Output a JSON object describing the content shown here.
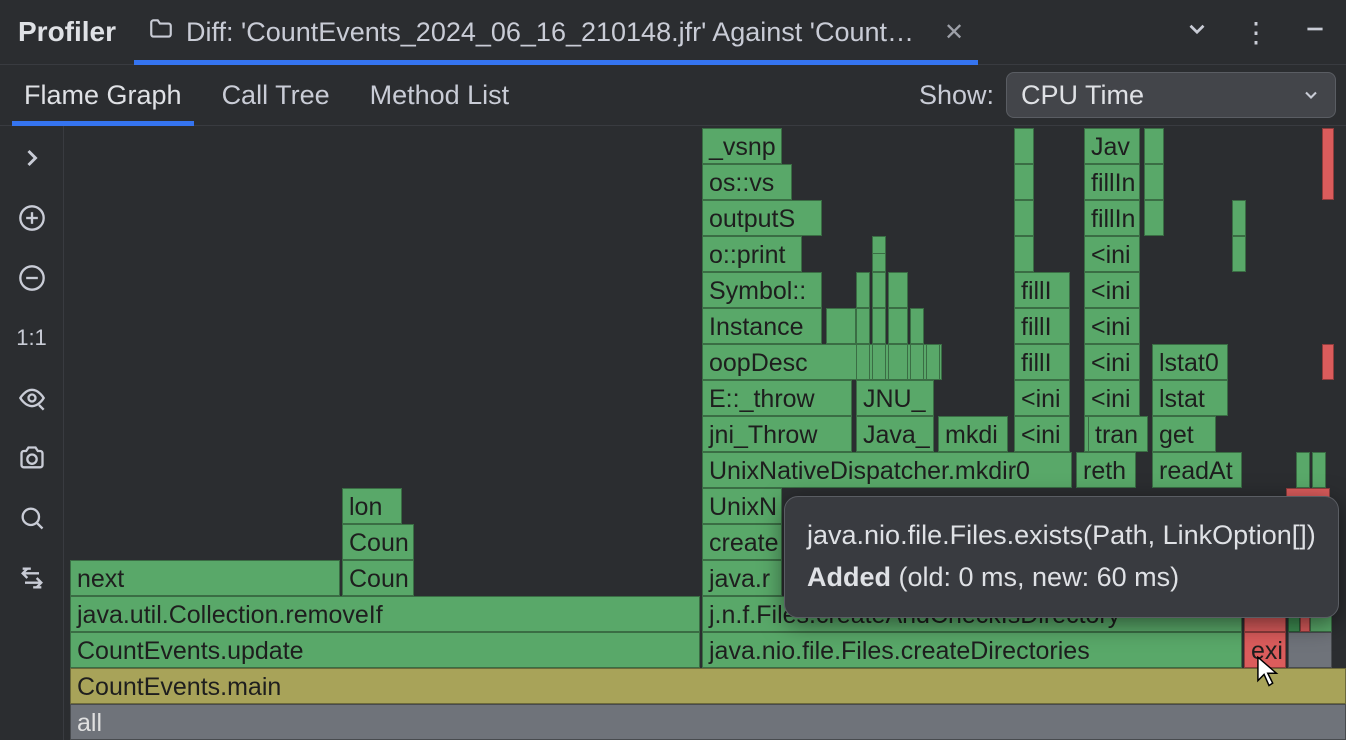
{
  "header": {
    "title": "Profiler",
    "tab_label": "Diff: 'CountEvents_2024_06_16_210148.jfr' Against 'CountEven…"
  },
  "subtabs": [
    "Flame Graph",
    "Call Tree",
    "Method List"
  ],
  "show_label": "Show:",
  "dropdown_value": "CPU Time",
  "toolbar": {
    "ratio": "1:1"
  },
  "tooltip": {
    "method": "java.nio.file.Files.exists(Path, LinkOption[])",
    "status_label": "Added",
    "status_detail": " (old: 0 ms, new: 60 ms)"
  },
  "flame": {
    "all": "all",
    "main": "CountEvents.main",
    "update": "CountEvents.update",
    "removeIf": "java.util.Collection.removeIf",
    "next": "next",
    "coun1": "Coun",
    "coun2": "Coun",
    "lon": "lon",
    "createDirs": "java.nio.file.Files.createDirectories",
    "createCheck": "j.n.f.Files.createAndCheckIsDirectory",
    "java_r": "java.r",
    "create": "create",
    "unixN": "UnixN",
    "unixDisp": "UnixNativeDispatcher.mkdir0",
    "jni_throw": "jni_Throw",
    "e_throw": "E::_throw",
    "oopDesc": "oopDesc",
    "instance": "Instance",
    "symbol": "Symbol::",
    "oprint": "o::print",
    "outputS": "outputS",
    "osvs": "os::vs",
    "vsnp": "_vsnp",
    "java_": "Java_",
    "mkdi": "mkdi",
    "jnu": "JNU_",
    "ini": "<ini",
    "fillI": "fillI",
    "reth": "reth",
    "readAt": "readAt",
    "get": "get",
    "tran": "tran",
    "lstat": "lstat",
    "lstat0": "lstat0",
    "fillIn": "fillIn",
    "jav": "Jav",
    "exi": "exi"
  }
}
